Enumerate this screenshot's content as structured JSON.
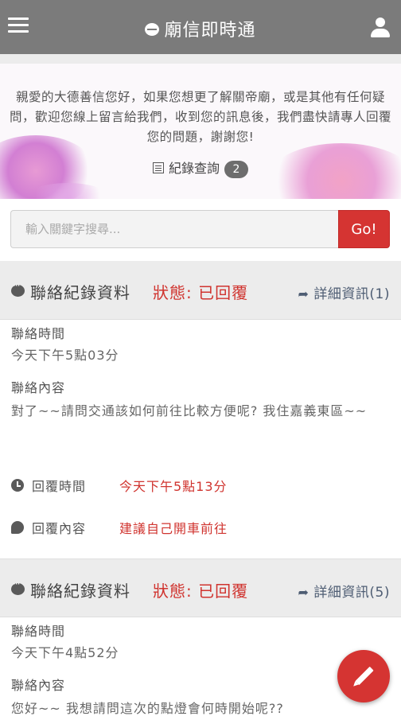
{
  "header": {
    "title": "廟信即時通",
    "menu_icon": "hamburger-menu-icon",
    "user_icon": "user-icon"
  },
  "banner": {
    "message": "親愛的大德善信您好，如果您想更了解關帝廟，或是其他有任何疑問，歡迎您線上留言給我們，收到您的訊息後，我們盡快請專人回覆您的問題，謝謝您!",
    "records_label": "紀錄查詢",
    "records_count": "2"
  },
  "search": {
    "placeholder": "輸入關鍵字搜尋...",
    "button_label": "Go!"
  },
  "records": [
    {
      "title": "聯絡紀錄資料",
      "status": "狀態: 已回覆",
      "detail_label": "詳細資訊(1)",
      "contact_time_label": "聯絡時間",
      "contact_time": "今天下午5點03分",
      "contact_content_label": "聯絡內容",
      "contact_content": "對了~~請問交通該如何前往比較方便呢? 我住嘉義東區~~",
      "reply_time_label": "回覆時間",
      "reply_time": "今天下午5點13分",
      "reply_content_label": "回覆內容",
      "reply_content": "建議自己開車前往"
    },
    {
      "title": "聯絡紀錄資料",
      "status": "狀態: 已回覆",
      "detail_label": "詳細資訊(5)",
      "contact_time_label": "聯絡時間",
      "contact_time": "今天下午4點52分",
      "contact_content_label": "聯絡內容",
      "contact_content": "您好~~ 我想請問這次的點燈會何時開始呢??"
    }
  ],
  "fab": {
    "icon": "pencil-icon"
  },
  "colors": {
    "header_bg": "#7b7b7b",
    "accent_red": "#d53432",
    "status_red": "#d0342f",
    "link_blue_gray": "#4e5d73"
  }
}
